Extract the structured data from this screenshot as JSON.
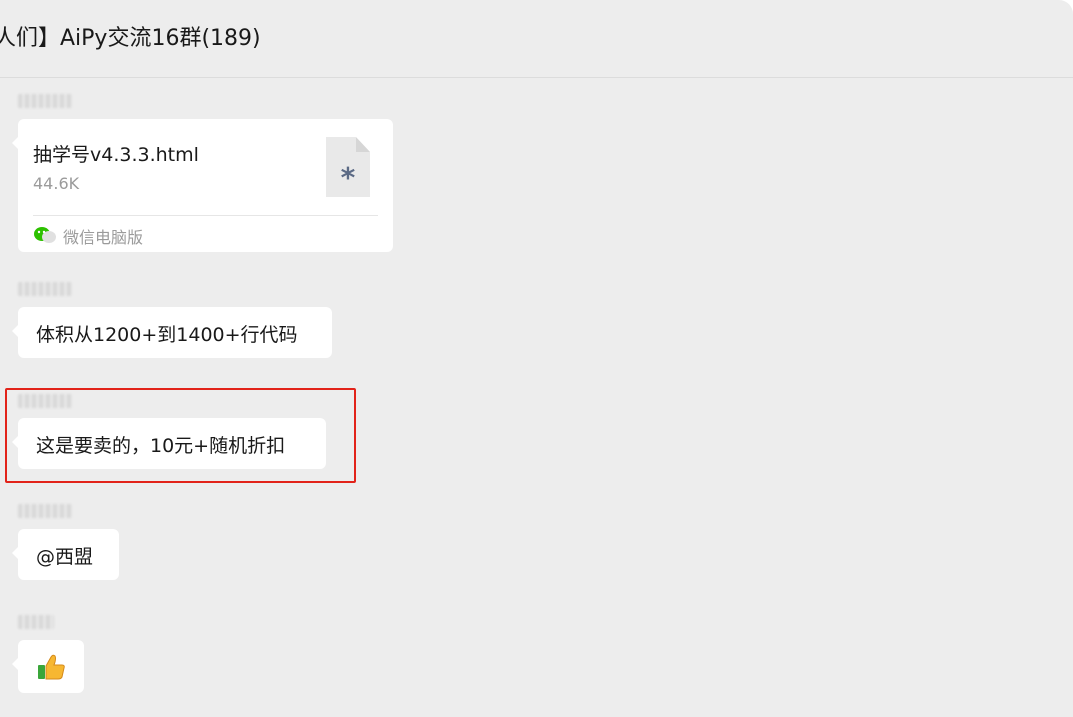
{
  "chat": {
    "title": "人们】AiPy交流16群(189)"
  },
  "messages": [
    {
      "type": "file",
      "file_name": "抽学号v4.3.3.html",
      "file_size": "44.6K",
      "file_icon": "file-unknown-icon",
      "source": "微信电脑版",
      "source_icon": "wechat-icon"
    },
    {
      "type": "text",
      "text": "体积从1200+到1400+行代码"
    },
    {
      "type": "text",
      "text": "这是要卖的，10元+随机折扣",
      "highlighted": true,
      "highlight_color": "#e2231a"
    },
    {
      "type": "text",
      "text": "@西盟"
    },
    {
      "type": "emoji",
      "emoji": "thumbs-up-icon"
    }
  ],
  "file_icon_glyph": "*",
  "colors": {
    "background": "#ededed",
    "bubble": "#ffffff",
    "highlight": "#e2231a",
    "wechat_green": "#2dc100"
  }
}
